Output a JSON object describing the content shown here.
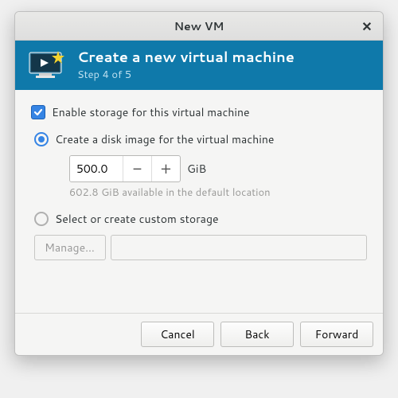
{
  "window": {
    "title": "New VM"
  },
  "header": {
    "title": "Create a new virtual machine",
    "step": "Step 4 of 5"
  },
  "storage": {
    "enable_label": "Enable storage for this virtual machine",
    "enable_checked": true,
    "create_image_label": "Create a disk image for the virtual machine",
    "create_image_selected": true,
    "size_value": "500.0",
    "size_unit": "GiB",
    "available_hint": "602.8 GiB available in the default location",
    "custom_label": "Select or create custom storage",
    "custom_selected": false,
    "manage_button": "Manage...",
    "custom_path": ""
  },
  "buttons": {
    "cancel": "Cancel",
    "back": "Back",
    "forward": "Forward"
  },
  "icons": {
    "close": "✕",
    "minus": "−",
    "plus": "+"
  }
}
